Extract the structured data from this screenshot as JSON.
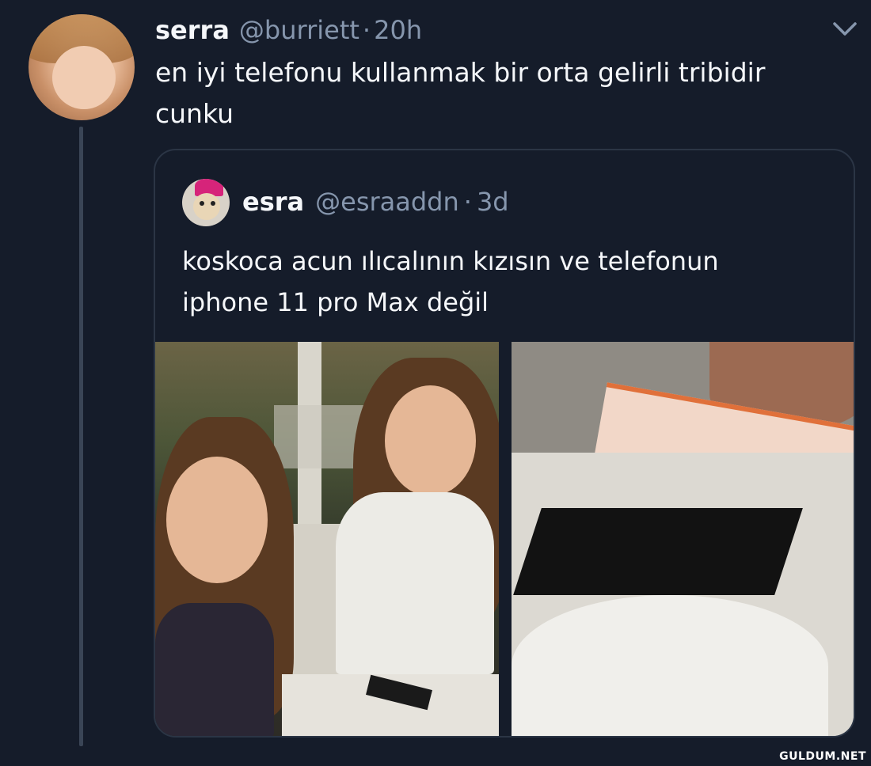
{
  "tweet": {
    "author_name": "serra",
    "author_handle": "@burriett",
    "separator": "·",
    "time": "20h",
    "text": "en iyi telefonu kullanmak bir orta gelirli tribidir\ncunku",
    "menu_icon": "chevron-down-icon"
  },
  "quoted_tweet": {
    "author_name": "esra",
    "author_handle": "@esraaddn",
    "separator": "·",
    "time": "3d",
    "text": "koskoca acun ılıcalının kızısın ve telefonun\niphone 11 pro Max değil",
    "media": [
      "photo-girls-at-table",
      "photo-phone-on-table"
    ]
  },
  "watermark": "GULDUM.NET",
  "colors": {
    "background": "#151c2a",
    "text_primary": "#f5f7fa",
    "text_secondary": "#8696ad",
    "border": "#2b3545"
  }
}
